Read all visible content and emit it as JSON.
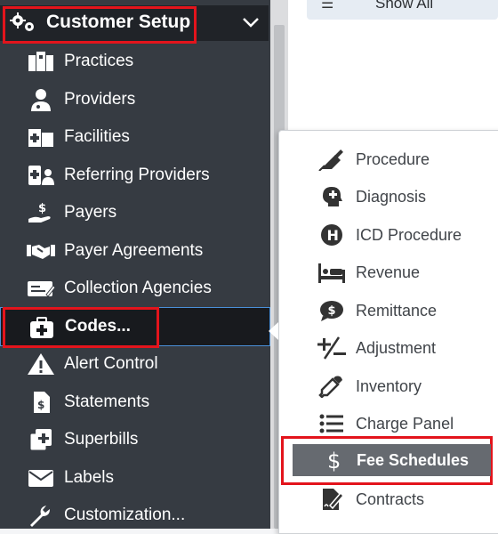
{
  "top_right": {
    "show_all_label": "Show All"
  },
  "sidebar": {
    "section_title": "Customer Setup",
    "items": [
      {
        "label": "Practices",
        "icon": "building-icon"
      },
      {
        "label": "Providers",
        "icon": "doctor-icon"
      },
      {
        "label": "Facilities",
        "icon": "hospital-icon"
      },
      {
        "label": "Referring Providers",
        "icon": "referral-icon"
      },
      {
        "label": "Payers",
        "icon": "hand-dollar-icon"
      },
      {
        "label": "Payer Agreements",
        "icon": "handshake-icon"
      },
      {
        "label": "Collection Agencies",
        "icon": "money-check-icon"
      },
      {
        "label": "Codes...",
        "icon": "medkit-icon"
      },
      {
        "label": "Alert Control",
        "icon": "warning-icon"
      },
      {
        "label": "Statements",
        "icon": "invoice-icon"
      },
      {
        "label": "Superbills",
        "icon": "copy-plus-icon"
      },
      {
        "label": "Labels",
        "icon": "envelope-icon"
      },
      {
        "label": "Customization...",
        "icon": "wrench-icon"
      }
    ]
  },
  "codes_menu": {
    "items": [
      {
        "label": "Procedure",
        "icon": "syringe-icon"
      },
      {
        "label": "Diagnosis",
        "icon": "head-medical-icon"
      },
      {
        "label": "ICD Procedure",
        "icon": "circle-h-icon"
      },
      {
        "label": "Revenue",
        "icon": "bed-icon"
      },
      {
        "label": "Remittance",
        "icon": "comment-dollar-icon"
      },
      {
        "label": "Adjustment",
        "icon": "plus-minus-icon"
      },
      {
        "label": "Inventory",
        "icon": "eye-dropper-icon"
      },
      {
        "label": "Charge Panel",
        "icon": "list-icon"
      },
      {
        "label": "Fee Schedules",
        "icon": "dollar-icon"
      },
      {
        "label": "Contracts",
        "icon": "signature-file-icon"
      }
    ]
  },
  "colors": {
    "sidebar_bg": "#363b42",
    "highlight_red": "#e3141c",
    "fee_selected_bg": "#666a70"
  }
}
